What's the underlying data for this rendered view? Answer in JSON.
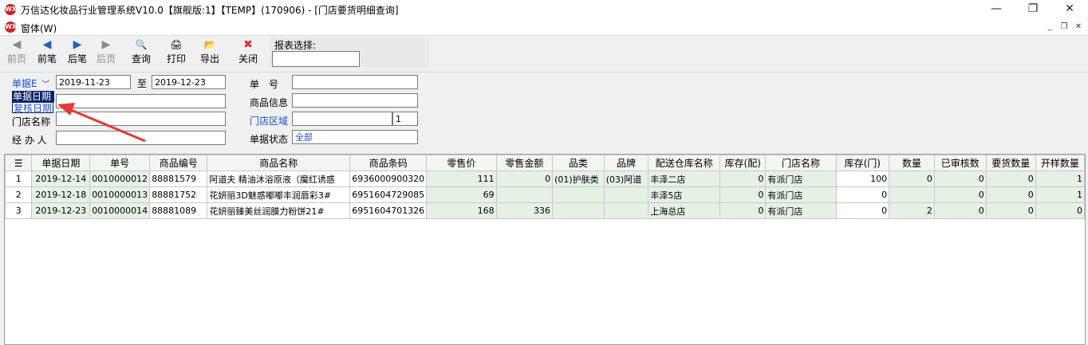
{
  "window": {
    "title": "万信达化妆品行业管理系统V10.0【旗舰版:1】【TEMP】(170906) - [门店要货明细查询]",
    "logo_text": "WX",
    "minimize_glyph": "—",
    "maximize_glyph": "❐",
    "close_glyph": "✕"
  },
  "menu": {
    "window_menu": "窗体(W)",
    "min_glyph": "_",
    "restore_glyph": "❐",
    "close_glyph": "✕"
  },
  "toolbar": {
    "buttons": [
      {
        "label": "前页",
        "icon": "first-page-icon",
        "glyph": "◀",
        "enabled": false
      },
      {
        "label": "前笔",
        "icon": "prev-record-icon",
        "glyph": "◀",
        "enabled": true
      },
      {
        "label": "后笔",
        "icon": "next-record-icon",
        "glyph": "▶",
        "enabled": true
      },
      {
        "label": "后页",
        "icon": "last-page-icon",
        "glyph": "▶",
        "enabled": false
      },
      {
        "label": "查询",
        "icon": "query-icon",
        "glyph": "🔍",
        "enabled": true
      },
      {
        "label": "打印",
        "icon": "print-icon",
        "glyph": "🖨",
        "enabled": true
      },
      {
        "label": "导出",
        "icon": "export-icon",
        "glyph": "📂",
        "enabled": true
      },
      {
        "label": "关闭",
        "icon": "close-icon",
        "glyph": "✖",
        "enabled": true
      }
    ],
    "report_label": "报表选择:",
    "report_value": ""
  },
  "filters": {
    "date_type_selected": "单据E",
    "date_options": [
      "单据日期",
      "复核日期"
    ],
    "date_from": "2019-11-23",
    "date_to_label": "至",
    "date_to": "2019-12-23",
    "doc_no_label": "单　号",
    "doc_no_value": "",
    "goods_info_label": "商品信息",
    "goods_info_value": "",
    "row2_value": "",
    "store_name_label": "门店名称",
    "store_name_value": "",
    "store_area_label": "门店区域",
    "store_area_value": "",
    "store_area_code": "1",
    "handler_label": "经 办 人",
    "handler_value": "",
    "doc_status_label": "单据状态",
    "doc_status_value": "全部"
  },
  "colors": {
    "highlight_row": "#e6f1e6",
    "arrow": "#e53935",
    "link_blue": "#1a4fd6",
    "selected_option_bg": "#0a246a"
  },
  "grid": {
    "corner_icon": "grid-menu-icon",
    "headers": [
      "单据日期",
      "单号",
      "商品编号",
      "商品名称",
      "商品条码",
      "零售价",
      "零售金额",
      "品类",
      "品牌",
      "配送仓库名称",
      "库存(配)",
      "门店名称",
      "库存(门)",
      "数量",
      "已审核数",
      "要货数量",
      "开样数量"
    ],
    "rows": [
      {
        "no": "1",
        "cells": [
          "2019-12-14",
          "0010000012",
          "88881579",
          "阿道夫 精油沐浴原液（魔红诱惑",
          "6936000900320",
          "111",
          "0",
          "(01)护肤类",
          "(03)阿道",
          "丰泽二店",
          "0",
          "有派门店",
          "100",
          "0",
          "0",
          "0",
          "1"
        ]
      },
      {
        "no": "2",
        "cells": [
          "2019-12-18",
          "0010000013",
          "88881752",
          "花妍丽3D魅惑嘟嘟丰润唇彩3#",
          "6951604729085",
          "69",
          "",
          "",
          "",
          "丰泽5店",
          "0",
          "有派门店",
          "0",
          "",
          "0",
          "0",
          "1"
        ]
      },
      {
        "no": "3",
        "cells": [
          "2019-12-23",
          "0010000014",
          "88881089",
          "花妍丽臻美丝润膜力粉饼21#",
          "6951604701326",
          "168",
          "336",
          "",
          "",
          "上海总店",
          "0",
          "有派门店",
          "0",
          "2",
          "0",
          "0",
          "0"
        ]
      }
    ]
  }
}
